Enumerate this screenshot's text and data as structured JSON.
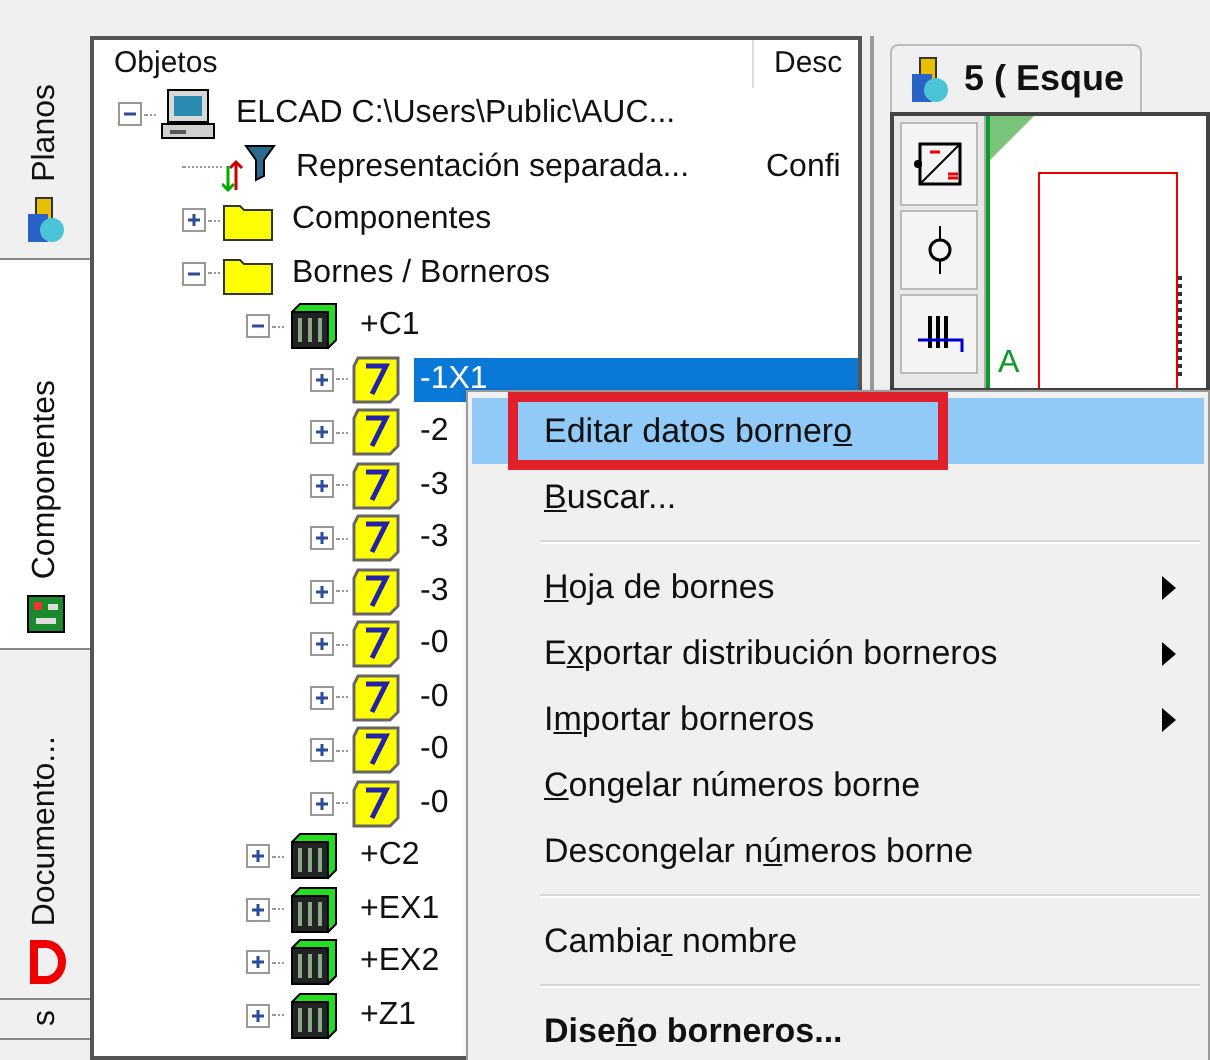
{
  "side_tabs": [
    {
      "label": "Planos",
      "kind": "plans",
      "selected": false
    },
    {
      "label": "Componentes",
      "kind": "board",
      "selected": true
    },
    {
      "label": "Documento...",
      "kind": "doc",
      "selected": false
    },
    {
      "label": "s",
      "kind": "plain",
      "selected": false
    }
  ],
  "tree": {
    "columns": [
      "Objetos",
      "Desc"
    ],
    "items": [
      {
        "label": "ELCAD C:\\Users\\Public\\AUC...",
        "kind": "computer",
        "expanded": true,
        "selected": false,
        "children": [
          {
            "label": "Representación separada...",
            "description": "Confi",
            "kind": "filter",
            "selected": false
          },
          {
            "label": "Componentes",
            "kind": "folder",
            "expanded": false,
            "selected": false
          },
          {
            "label": "Bornes / Borneros",
            "kind": "folder",
            "expanded": true,
            "selected": false,
            "children": [
              {
                "label": "+C1",
                "kind": "rack",
                "expanded": true,
                "selected": false,
                "children": [
                  {
                    "label": "-1X1",
                    "kind": "terminal",
                    "expanded": false,
                    "selected": true
                  },
                  {
                    "label": "-2",
                    "kind": "terminal",
                    "expanded": false,
                    "selected": false
                  },
                  {
                    "label": "-3",
                    "kind": "terminal",
                    "expanded": false,
                    "selected": false
                  },
                  {
                    "label": "-3",
                    "kind": "terminal",
                    "expanded": false,
                    "selected": false
                  },
                  {
                    "label": "-3",
                    "kind": "terminal",
                    "expanded": false,
                    "selected": false
                  },
                  {
                    "label": "-0",
                    "kind": "terminal",
                    "expanded": false,
                    "selected": false
                  },
                  {
                    "label": "-0",
                    "kind": "terminal",
                    "expanded": false,
                    "selected": false
                  },
                  {
                    "label": "-0",
                    "kind": "terminal",
                    "expanded": false,
                    "selected": false
                  },
                  {
                    "label": "-0",
                    "kind": "terminal",
                    "expanded": false,
                    "selected": false
                  }
                ]
              },
              {
                "label": "+C2",
                "kind": "rack",
                "expanded": false,
                "selected": false
              },
              {
                "label": "+EX1",
                "kind": "rack",
                "expanded": false,
                "selected": false
              },
              {
                "label": "+EX2",
                "kind": "rack",
                "expanded": false,
                "selected": false
              },
              {
                "label": "+Z1",
                "kind": "rack",
                "expanded": false,
                "selected": false
              }
            ]
          }
        ]
      }
    ]
  },
  "document_tab": {
    "label": "5 ( Esque"
  },
  "canvas": {
    "letter": "A"
  },
  "context_menu": [
    {
      "kind": "item",
      "before": "Editar datos borner",
      "key": "o",
      "selected": true,
      "submenu": false,
      "default": false
    },
    {
      "kind": "item",
      "key": "B",
      "after": "uscar...",
      "selected": false,
      "submenu": false,
      "default": false
    },
    {
      "kind": "separator"
    },
    {
      "kind": "item",
      "key": "H",
      "after": "oja de bornes",
      "selected": false,
      "submenu": true,
      "default": false
    },
    {
      "kind": "item",
      "before": "E",
      "key": "x",
      "after": "portar distribución borneros",
      "selected": false,
      "submenu": true,
      "default": false
    },
    {
      "kind": "item",
      "before": "I",
      "key": "m",
      "after": "portar borneros",
      "selected": false,
      "submenu": true,
      "default": false
    },
    {
      "kind": "item",
      "key": "C",
      "after": "ongelar números borne",
      "selected": false,
      "submenu": false,
      "default": false
    },
    {
      "kind": "item",
      "before": "Descongelar n",
      "key": "ú",
      "after": "meros borne",
      "selected": false,
      "submenu": false,
      "default": false
    },
    {
      "kind": "separator"
    },
    {
      "kind": "item",
      "before": "Cambia",
      "key": "r",
      "after": " nombre",
      "selected": false,
      "submenu": false,
      "default": false
    },
    {
      "kind": "separator"
    },
    {
      "kind": "item",
      "before": "Dise",
      "key": "ñ",
      "after": "o borneros...",
      "selected": false,
      "submenu": false,
      "default": true
    }
  ]
}
